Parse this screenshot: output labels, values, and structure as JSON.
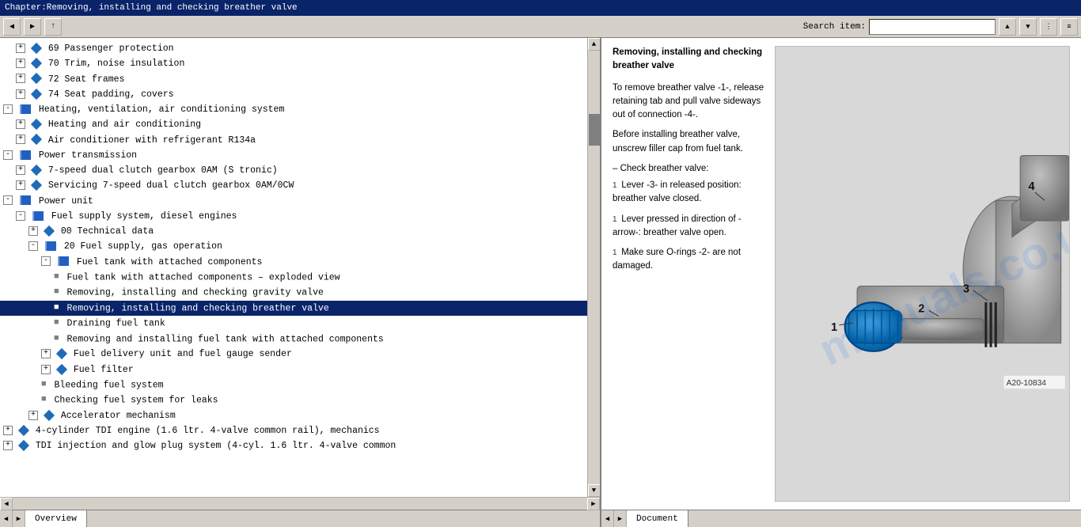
{
  "titlebar": {
    "text": "Chapter:Removing, installing and checking breather valve"
  },
  "toolbar": {
    "search_label": "Search item:",
    "search_placeholder": ""
  },
  "tree": {
    "items": [
      {
        "id": 1,
        "indent": 1,
        "type": "diamond-expand",
        "text": "69  Passenger protection",
        "selected": false
      },
      {
        "id": 2,
        "indent": 1,
        "type": "diamond-expand",
        "text": "70  Trim, noise insulation",
        "selected": false
      },
      {
        "id": 3,
        "indent": 1,
        "type": "diamond-expand",
        "text": "72  Seat frames",
        "selected": false
      },
      {
        "id": 4,
        "indent": 1,
        "type": "diamond-expand",
        "text": "74  Seat padding, covers",
        "selected": false
      },
      {
        "id": 5,
        "indent": 0,
        "type": "book-expand",
        "text": "Heating, ventilation, air conditioning system",
        "selected": false
      },
      {
        "id": 6,
        "indent": 1,
        "type": "diamond-expand",
        "text": "Heating and air conditioning",
        "selected": false
      },
      {
        "id": 7,
        "indent": 1,
        "type": "diamond-expand",
        "text": "Air conditioner with refrigerant R134a",
        "selected": false
      },
      {
        "id": 8,
        "indent": 0,
        "type": "book-expand",
        "text": "Power transmission",
        "selected": false
      },
      {
        "id": 9,
        "indent": 1,
        "type": "diamond-expand",
        "text": "7-speed dual clutch gearbox 0AM (S tronic)",
        "selected": false
      },
      {
        "id": 10,
        "indent": 1,
        "type": "diamond-expand",
        "text": "Servicing 7-speed dual clutch gearbox 0AM/0CW",
        "selected": false
      },
      {
        "id": 11,
        "indent": 0,
        "type": "book-expand",
        "text": "Power unit",
        "selected": false
      },
      {
        "id": 12,
        "indent": 1,
        "type": "book-expand",
        "text": "Fuel supply system, diesel engines",
        "selected": false
      },
      {
        "id": 13,
        "indent": 2,
        "type": "diamond-expand",
        "text": "00  Technical data",
        "selected": false
      },
      {
        "id": 14,
        "indent": 2,
        "type": "book-expand",
        "text": "20  Fuel supply, gas operation",
        "selected": false
      },
      {
        "id": 15,
        "indent": 3,
        "type": "book-expand",
        "text": "Fuel tank with attached components",
        "selected": false
      },
      {
        "id": 16,
        "indent": 4,
        "type": "doc",
        "text": "Fuel tank with attached components – exploded view",
        "selected": false
      },
      {
        "id": 17,
        "indent": 4,
        "type": "doc",
        "text": "Removing, installing and checking gravity valve",
        "selected": false
      },
      {
        "id": 18,
        "indent": 4,
        "type": "doc",
        "text": "Removing, installing and checking breather valve",
        "selected": true
      },
      {
        "id": 19,
        "indent": 4,
        "type": "doc",
        "text": "Draining fuel tank",
        "selected": false
      },
      {
        "id": 20,
        "indent": 4,
        "type": "doc",
        "text": "Removing and installing fuel tank with attached components",
        "selected": false
      },
      {
        "id": 21,
        "indent": 3,
        "type": "diamond-expand",
        "text": "Fuel delivery unit and fuel gauge sender",
        "selected": false
      },
      {
        "id": 22,
        "indent": 3,
        "type": "diamond-expand",
        "text": "Fuel filter",
        "selected": false
      },
      {
        "id": 23,
        "indent": 3,
        "type": "doc",
        "text": "Bleeding fuel system",
        "selected": false
      },
      {
        "id": 24,
        "indent": 3,
        "type": "doc",
        "text": "Checking fuel system for leaks",
        "selected": false
      },
      {
        "id": 25,
        "indent": 2,
        "type": "diamond-expand",
        "text": "Accelerator mechanism",
        "selected": false
      },
      {
        "id": 26,
        "indent": 0,
        "type": "diamond-expand",
        "text": "4-cylinder TDI engine (1.6 ltr. 4-valve common rail), mechanics",
        "selected": false
      },
      {
        "id": 27,
        "indent": 0,
        "type": "diamond-expand",
        "text": "TDI injection and glow plug system (4-cyl. 1.6 ltr. 4-valve common",
        "selected": false
      }
    ]
  },
  "content": {
    "title": "Removing, installing and checking breather valve",
    "paragraphs": [
      {
        "prefix": "",
        "text": "To remove breather valve -1-, release retaining tab and pull valve sideways out of connection -4-."
      },
      {
        "prefix": "",
        "text": "Before installing breather valve, unscrew filler cap from fuel tank."
      },
      {
        "prefix": "–",
        "text": "Check breather valve:"
      },
      {
        "prefix": "",
        "text": "Lever -3- in released position: breather valve closed."
      },
      {
        "prefix": "",
        "text": "Lever pressed in direction of -arrow-: breather valve open."
      },
      {
        "prefix": "",
        "text": "Make sure O-rings -2- are not damaged."
      }
    ],
    "lever_text": "Lever -3- in released",
    "image_ref": "A20-10834",
    "watermark": "manuals.co.uk",
    "diagram_labels": [
      "1",
      "2",
      "3",
      "4"
    ]
  },
  "statusbar": {
    "left_tab": "Overview",
    "right_tab": "Document"
  }
}
